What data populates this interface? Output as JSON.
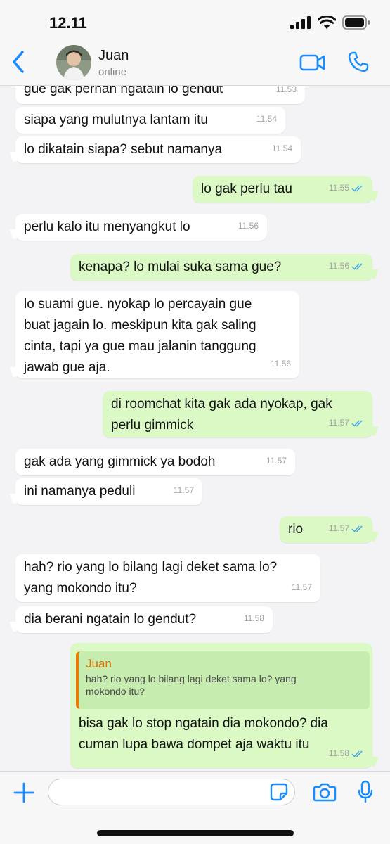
{
  "status_bar": {
    "time": "12.11"
  },
  "header": {
    "contact_name": "Juan",
    "contact_status": "online"
  },
  "colors": {
    "accent": "#1a8cff",
    "outgoing_bubble": "#dbf9c4",
    "incoming_bubble": "#ffffff",
    "quote_name": "#e07000"
  },
  "messages": [
    {
      "text": "gue gak pernah ngatain lo gendut",
      "time": "11.53",
      "dir": "in"
    },
    {
      "text": "siapa yang mulutnya lantam itu",
      "time": "11.54",
      "dir": "in"
    },
    {
      "text": "lo dikatain siapa? sebut namanya",
      "time": "11.54",
      "dir": "in"
    },
    {
      "text": "lo gak perlu tau",
      "time": "11.55",
      "dir": "out",
      "read": true
    },
    {
      "text": "perlu kalo itu menyangkut lo",
      "time": "11.56",
      "dir": "in"
    },
    {
      "text": "kenapa? lo mulai suka sama gue?",
      "time": "11.56",
      "dir": "out",
      "read": true
    },
    {
      "text": "lo suami gue. nyokap lo percayain gue\nbuat jagain lo. meskipun kita gak saling\ncinta, tapi ya gue mau jalanin tanggung\njawab gue aja.",
      "time": "11.56",
      "dir": "in"
    },
    {
      "text": "di roomchat kita gak ada nyokap, gak\nperlu gimmick",
      "time": "11.57",
      "dir": "out",
      "read": true
    },
    {
      "text": "gak ada yang gimmick ya bodoh",
      "time": "11.57",
      "dir": "in"
    },
    {
      "text": "ini namanya peduli",
      "time": "11.57",
      "dir": "in"
    },
    {
      "text": "rio",
      "time": "11.57",
      "dir": "out",
      "read": true
    },
    {
      "text": "hah? rio yang lo bilang lagi deket sama lo?\nyang mokondo itu?",
      "time": "11.57",
      "dir": "in"
    },
    {
      "text": "dia berani ngatain lo gendut?",
      "time": "11.58",
      "dir": "in"
    },
    {
      "text": "bisa gak lo stop ngatain dia mokondo? dia\ncuman lupa bawa dompet aja waktu itu",
      "time": "11.58",
      "dir": "out",
      "read": true,
      "reply_to": {
        "name": "Juan",
        "text": "hah? rio yang lo bilang lagi deket sama lo? yang\nmokondo itu?"
      }
    }
  ],
  "input": {
    "value": "",
    "placeholder": ""
  },
  "icons": {
    "back": "chevron-left-icon",
    "video": "video-icon",
    "call": "phone-icon",
    "plus": "plus-icon",
    "sticker": "sticker-icon",
    "camera": "camera-icon",
    "mic": "microphone-icon",
    "read": "double-check-icon"
  }
}
